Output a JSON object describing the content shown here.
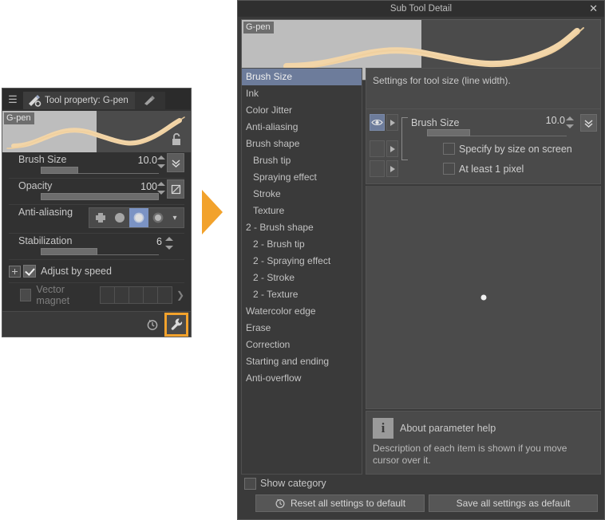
{
  "tool_property": {
    "tab_label": "Tool property: G-pen",
    "hamburger_icon": "menu-icon",
    "preview_label": "G-pen",
    "lock_icon": "unlock-icon",
    "rows": [
      {
        "label": "Brush Size",
        "value": "10.0",
        "button_icon": "double-chevron-down-icon",
        "fill_pct": 32
      },
      {
        "label": "Opacity",
        "value": "100",
        "button_icon": "no-blend-icon",
        "fill_pct": 100
      }
    ],
    "antialiasing": {
      "label": "Anti-aliasing",
      "options": [
        "none-icon",
        "weak-icon",
        "medium-icon",
        "strong-icon"
      ],
      "selected_index": 2,
      "caret_icon": "chevron-down-icon"
    },
    "stabilization": {
      "label": "Stabilization",
      "value": "6",
      "fill_pct": 48
    },
    "adjust_by_speed": {
      "label": "Adjust by speed",
      "checked": true
    },
    "vector_magnet": {
      "label": "Vector magnet",
      "checked": false,
      "cells": 5,
      "arrow_icon": "chevron-right-icon"
    },
    "footer": {
      "history_icon": "reset-clock-icon",
      "wrench_icon": "wrench-icon",
      "highlight_color": "#f2a22c"
    }
  },
  "annotation": {
    "arrow_icon": "arrow-right-triangle",
    "color": "#f2a22c"
  },
  "sub_tool_detail": {
    "title": "Sub Tool Detail",
    "close_icon": "close-icon",
    "preview_label": "G-pen",
    "categories": [
      {
        "label": "Brush Size",
        "indent": false,
        "selected": true
      },
      {
        "label": "Ink",
        "indent": false,
        "selected": false
      },
      {
        "label": "Color Jitter",
        "indent": false,
        "selected": false
      },
      {
        "label": "Anti-aliasing",
        "indent": false,
        "selected": false
      },
      {
        "label": "Brush shape",
        "indent": false,
        "selected": false
      },
      {
        "label": "Brush tip",
        "indent": true,
        "selected": false
      },
      {
        "label": "Spraying effect",
        "indent": true,
        "selected": false
      },
      {
        "label": "Stroke",
        "indent": true,
        "selected": false
      },
      {
        "label": "Texture",
        "indent": true,
        "selected": false
      },
      {
        "label": "2 - Brush shape",
        "indent": false,
        "selected": false
      },
      {
        "label": "2 - Brush tip",
        "indent": true,
        "selected": false
      },
      {
        "label": "2 - Spraying effect",
        "indent": true,
        "selected": false
      },
      {
        "label": "2 - Stroke",
        "indent": true,
        "selected": false
      },
      {
        "label": "2 - Texture",
        "indent": true,
        "selected": false
      },
      {
        "label": "Watercolor edge",
        "indent": false,
        "selected": false
      },
      {
        "label": "Erase",
        "indent": false,
        "selected": false
      },
      {
        "label": "Correction",
        "indent": false,
        "selected": false
      },
      {
        "label": "Starting and ending",
        "indent": false,
        "selected": false
      },
      {
        "label": "Anti-overflow",
        "indent": false,
        "selected": false
      }
    ],
    "description": "Settings for tool size (line width).",
    "params": {
      "brush_size": {
        "label": "Brush Size",
        "value": "10.0",
        "fill_pct": 31,
        "eye_icon": "eye-icon",
        "expand_icon": "triangle-right-icon",
        "button_icon": "double-chevron-down-icon"
      },
      "specify_by_size": {
        "label": "Specify by size on screen",
        "checked": false,
        "expand_icon": "triangle-right-icon"
      },
      "at_least_1_pixel": {
        "label": "At least 1  pixel",
        "checked": false,
        "expand_icon": "triangle-right-icon"
      }
    },
    "help": {
      "icon": "info-icon",
      "title": "About parameter help",
      "text": "Description of each item is shown if you move cursor over it."
    },
    "show_category": {
      "label": "Show category",
      "checked": false
    },
    "buttons": {
      "reset": {
        "label": "Reset all settings to default",
        "icon": "reset-clock-icon"
      },
      "save": {
        "label": "Save all settings as default"
      }
    }
  }
}
